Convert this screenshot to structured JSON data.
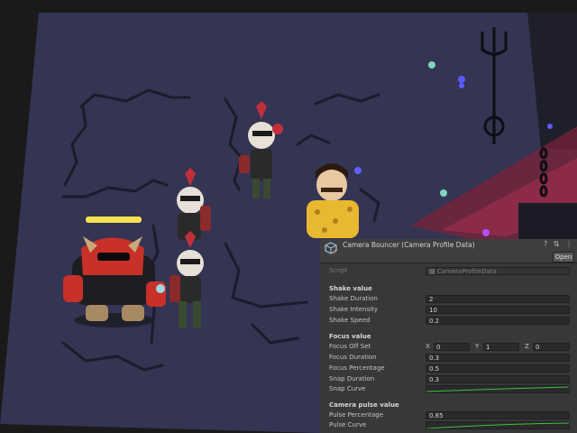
{
  "inspector": {
    "title": "Camera Bouncer (Camera Profile Data)",
    "header_icons": "? ⇅ ⋮",
    "open_label": "Open",
    "script_label": "Script",
    "script_value": "CameraProfileData",
    "sections": {
      "shake": {
        "header": "Shake value",
        "duration_label": "Shake Duration",
        "duration_value": "2",
        "intensity_label": "Shake Intensity",
        "intensity_value": "10",
        "speed_label": "Shake Speed",
        "speed_value": "0.2"
      },
      "focus": {
        "header": "Focus value",
        "offset_label": "Focus Off Set",
        "offset_x_label": "X",
        "offset_x": "0",
        "offset_y_label": "Y",
        "offset_y": "1",
        "offset_z_label": "Z",
        "offset_z": "0",
        "duration_label": "Focus Duration",
        "duration_value": "0.3",
        "percentage_label": "Focus Percentage",
        "percentage_value": "0.5",
        "snap_duration_label": "Snap Duration",
        "snap_duration_value": "0.3",
        "snap_curve_label": "Snap Curve"
      },
      "pulse": {
        "header": "Camera pulse value",
        "percentage_label": "Pulse Percentage",
        "percentage_value": "0.85",
        "curve_label": "Pulse Curve"
      }
    }
  },
  "colors": {
    "background": "#1a1a1a",
    "floor": "#343453",
    "inspector_bg": "#383838",
    "curve_green": "#3fbf3f",
    "health_bar": "#f5e050",
    "boss_red": "#c8302a"
  },
  "icons": [
    "scriptable-object-icon",
    "help-icon",
    "preset-icon",
    "menu-icon",
    "script-icon",
    "trident-icon",
    "chain-icon",
    "spark-icon"
  ]
}
